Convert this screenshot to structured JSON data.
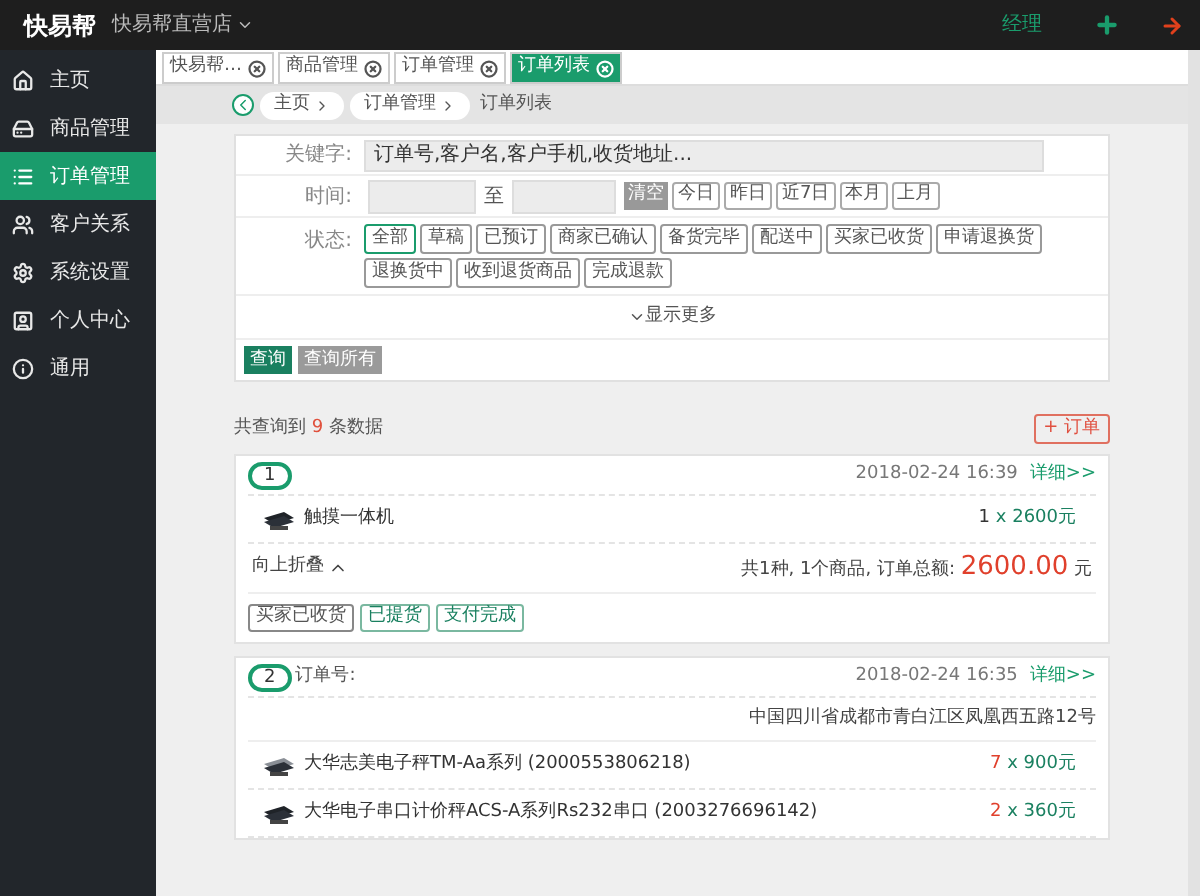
{
  "header": {
    "brand": "快易帮",
    "store": "快易帮直营店",
    "user": "经理"
  },
  "sidebar": {
    "items": [
      {
        "label": "主页",
        "selected": false
      },
      {
        "label": "商品管理",
        "selected": false
      },
      {
        "label": "订单管理",
        "selected": true
      },
      {
        "label": "客户关系",
        "selected": false
      },
      {
        "label": "系统设置",
        "selected": false
      },
      {
        "label": "个人中心",
        "selected": false
      },
      {
        "label": "通用",
        "selected": false
      }
    ]
  },
  "tabs": [
    {
      "label": "快易帮…",
      "selected": false
    },
    {
      "label": "商品管理",
      "selected": false
    },
    {
      "label": "订单管理",
      "selected": false
    },
    {
      "label": "订单列表",
      "selected": true
    }
  ],
  "breadcrumb": [
    "主页",
    "订单管理",
    "订单列表"
  ],
  "filters": {
    "keyword": {
      "label": "关键字:",
      "placeholder": "订单号,客户名,客户手机,收货地址..."
    },
    "time": {
      "label": "时间:",
      "separator": "至",
      "clear": "清空",
      "quick": [
        "今日",
        "昨日",
        "近7日",
        "本月",
        "上月"
      ]
    },
    "status": {
      "label": "状态:",
      "options": [
        {
          "label": "全部",
          "selected": true
        },
        {
          "label": "草稿",
          "selected": false
        },
        {
          "label": "已预订",
          "selected": false
        },
        {
          "label": "商家已确认",
          "selected": false
        },
        {
          "label": "备货完毕",
          "selected": false
        },
        {
          "label": "配送中",
          "selected": false
        },
        {
          "label": "买家已收货",
          "selected": false
        },
        {
          "label": "申请退换货",
          "selected": false
        },
        {
          "label": "退换货中",
          "selected": false
        },
        {
          "label": "收到退货商品",
          "selected": false
        },
        {
          "label": "完成退款",
          "selected": false
        }
      ]
    },
    "more": "显示更多",
    "query": "查询",
    "query_all": "查询所有"
  },
  "summary": {
    "prefix": "共查询到",
    "count": "9",
    "suffix": "条数据",
    "add_button": "+ 订单"
  },
  "orders": [
    {
      "index": "1",
      "time": "2018-02-24 16:39",
      "detail": "详细>>",
      "items": [
        {
          "name": "触摸一体机",
          "qty": "1",
          "price": "x 2600元",
          "highlight": false
        }
      ],
      "collapse": "向上折叠",
      "total_text": "共1种, 1个商品, 订单总额:",
      "total": "2600.00",
      "currency": "元",
      "tags": [
        {
          "label": "买家已收货",
          "kind": "neutral"
        },
        {
          "label": "已提货",
          "kind": "success"
        },
        {
          "label": "支付完成",
          "kind": "success"
        }
      ]
    },
    {
      "index": "2",
      "order_no_label": "订单号:",
      "time": "2018-02-24 16:35",
      "detail": "详细>>",
      "address": "中国四川省成都市青白江区凤凰西五路12号",
      "items": [
        {
          "name": "大华志美电子秤TM-Aa系列 (2000553806218)",
          "qty": "7",
          "price": "x 900元",
          "highlight": true
        },
        {
          "name": "大华电子串口计价秤ACS-A系列Rs232串口 (2003276696142)",
          "qty": "2",
          "price": "x 360元",
          "highlight": true
        }
      ]
    }
  ]
}
